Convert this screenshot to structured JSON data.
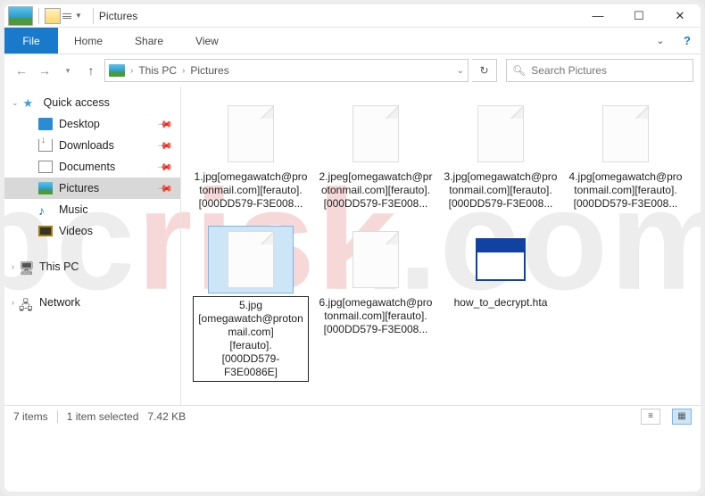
{
  "titlebar": {
    "title": "Pictures"
  },
  "ribbon": {
    "file": "File",
    "tabs": [
      "Home",
      "Share",
      "View"
    ]
  },
  "breadcrumb": {
    "root": "This PC",
    "folder": "Pictures",
    "chevron": "›"
  },
  "search": {
    "placeholder": "Search Pictures"
  },
  "sidebar": {
    "quick_access": "Quick access",
    "items": [
      {
        "label": "Desktop",
        "pinned": true
      },
      {
        "label": "Downloads",
        "pinned": true
      },
      {
        "label": "Documents",
        "pinned": true
      },
      {
        "label": "Pictures",
        "pinned": true,
        "selected": true
      },
      {
        "label": "Music",
        "pinned": false
      },
      {
        "label": "Videos",
        "pinned": false
      }
    ],
    "this_pc": "This PC",
    "network": "Network"
  },
  "files": [
    {
      "name_lines": "1.jpg[omegawatch@protonmail.com][ferauto].[000DD579-F3E008...",
      "icon": "blank"
    },
    {
      "name_lines": "2.jpeg[omegawatch@protonmail.com][ferauto].[000DD579-F3E008...",
      "icon": "blank"
    },
    {
      "name_lines": "3.jpg[omegawatch@protonmail.com][ferauto].[000DD579-F3E008...",
      "icon": "blank"
    },
    {
      "name_lines": "4.jpg[omegawatch@protonmail.com][ferauto].[000DD579-F3E008...",
      "icon": "blank"
    },
    {
      "name_lines": "5.jpg\n[omegawatch@protonmail.com]\n[ferauto].\n[000DD579-F3E0086E]",
      "icon": "blank",
      "selected": true,
      "boxed": true
    },
    {
      "name_lines": "6.jpg[omegawatch@protonmail.com][ferauto].[000DD579-F3E008...",
      "icon": "blank"
    },
    {
      "name_lines": "how_to_decrypt.hta",
      "icon": "hta"
    }
  ],
  "statusbar": {
    "count": "7 items",
    "selection": "1 item selected",
    "size": "7.42 KB"
  }
}
